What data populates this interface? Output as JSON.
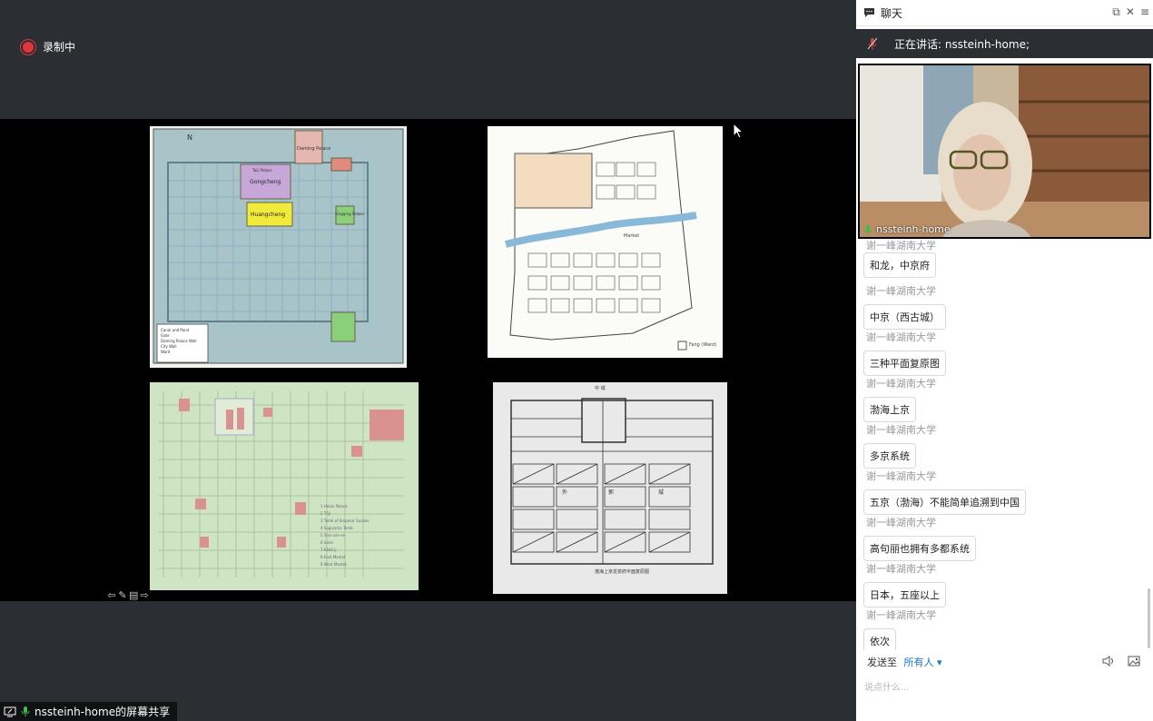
{
  "recording": {
    "label": "录制中"
  },
  "share_label": "nssteinh-home的屏幕共享",
  "chat": {
    "title": "聊天",
    "speaking": "正在讲话: nssteinh-home;",
    "video_name": "nssteinh-home",
    "first_partial_sender": "谢一峰湖南大学",
    "messages": [
      {
        "sender": "谢一峰湖南大学",
        "text": "和龙，中京府"
      },
      {
        "sender": "谢一峰湖南大学",
        "text": "中京（西古城）"
      },
      {
        "sender": "谢一峰湖南大学",
        "text": "三种平面复原图"
      },
      {
        "sender": "谢一峰湖南大学",
        "text": "渤海上京"
      },
      {
        "sender": "谢一峰湖南大学",
        "text": "多京系统"
      },
      {
        "sender": "谢一峰湖南大学",
        "text": "五京（渤海）不能简单追溯到中国"
      },
      {
        "sender": "谢一峰湖南大学",
        "text": "高句丽也拥有多都系统"
      },
      {
        "sender": "谢一峰湖南大学",
        "text": "日本，五座以上"
      },
      {
        "sender": "谢一峰湖南大学",
        "text": "依次"
      }
    ],
    "send_to_label": "发送至",
    "send_to_target": "所有人 ▾",
    "input_placeholder": "说点什么..."
  },
  "slide": {
    "map1_labels": {
      "north": "N",
      "palace": "Daming Palace",
      "gongcheng": "Gongcheng",
      "huangcheng": "Huangcheng",
      "taiji": "Taiji Palace",
      "xingqing": "Xingqing Palace"
    },
    "map1_legend": [
      "Canal and Pond",
      "Gate",
      "Daming Palace Wall",
      "City Wall",
      "Ward"
    ],
    "map2_labels": {
      "title": "",
      "market": "Market",
      "scale": "Fang (Ward)"
    },
    "map3_legend": [
      "1 Heian Palace",
      "2 Tōji",
      "3 Tomb of Emperor Suzaku",
      "4 Sugiyama Tomb",
      "5 Shin-sen-en",
      "6 Sairo",
      "7 Kōdō-ji",
      "8 East Market",
      "9 West Market"
    ],
    "map4_labels": {
      "top": "中 城",
      "left": "外",
      "mid": "郭",
      "right": "城",
      "caption": "渤海上京龙泉府平面复原图"
    }
  },
  "icons": [
    "record-dot-icon",
    "chat-icon",
    "popout-icon",
    "close-icon",
    "menu-icon",
    "mic-muted-icon",
    "mic-icon",
    "speaker-icon",
    "image-icon",
    "share-screen-icon"
  ],
  "colors": {
    "accent": "#1a73c8",
    "recording": "#e0353a",
    "mic_green": "#3fb950"
  }
}
